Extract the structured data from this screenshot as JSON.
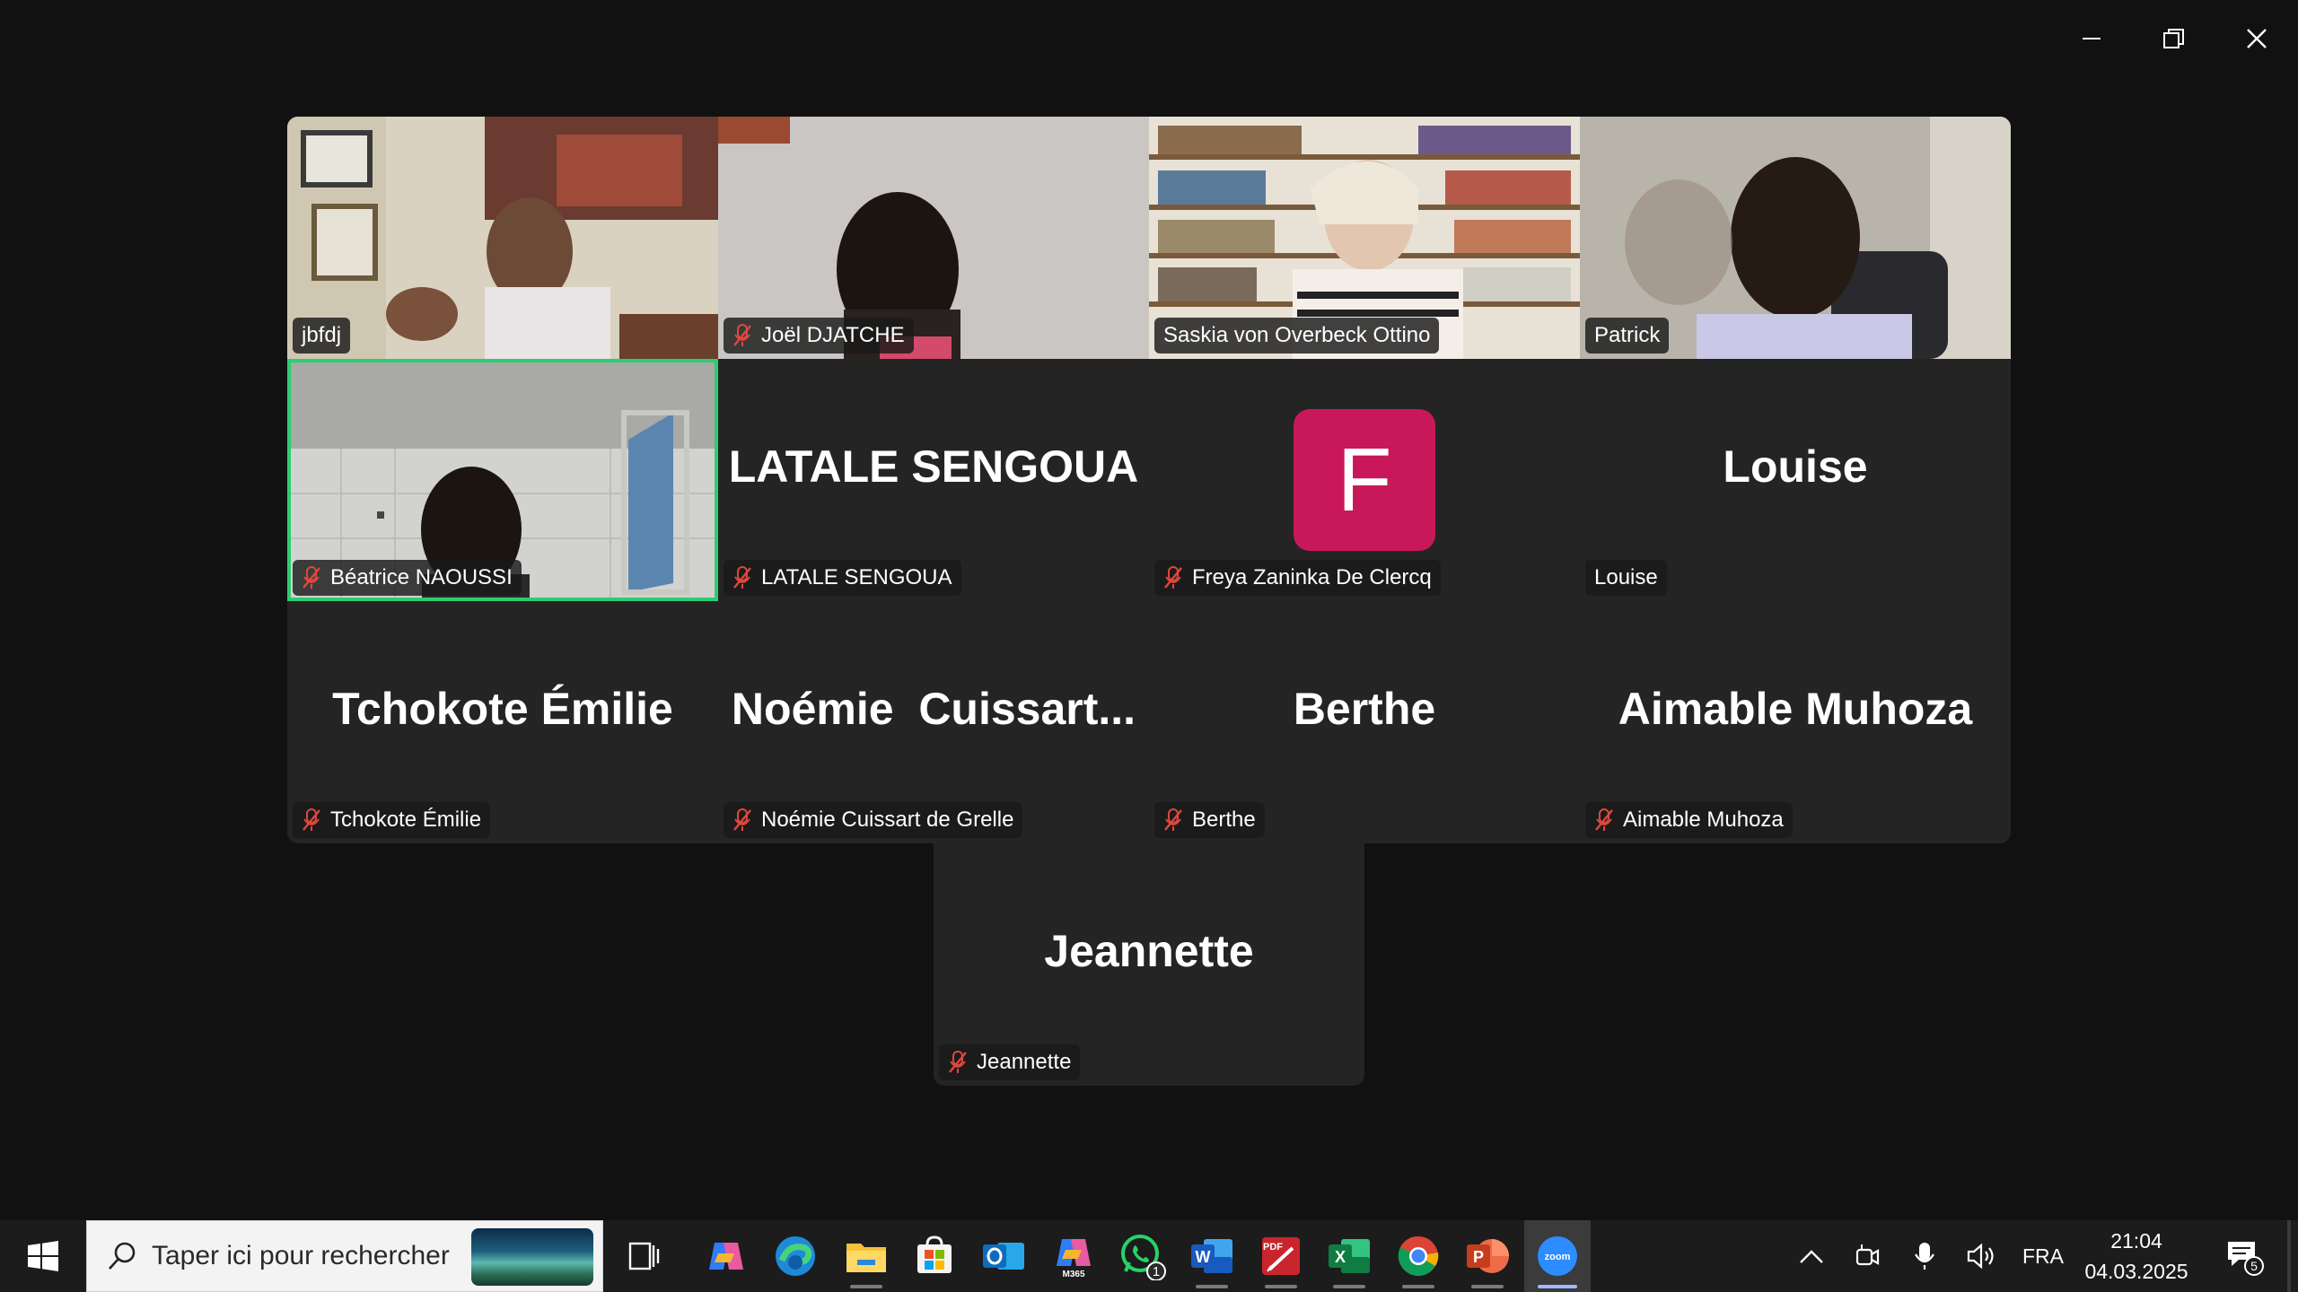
{
  "window_controls": [
    "minimize-icon",
    "restore-icon",
    "close-icon"
  ],
  "participants": [
    {
      "name": "jbfdj",
      "muted": false,
      "video": true
    },
    {
      "name": "Joël DJATCHE",
      "muted": true,
      "video": true
    },
    {
      "name": "Saskia von Overbeck Ottino",
      "muted": false,
      "video": true
    },
    {
      "name": "Patrick",
      "muted": false,
      "video": true
    },
    {
      "name": "Béatrice NAOUSSI",
      "muted": true,
      "video": true,
      "active_speaker": true
    },
    {
      "name": "LATALE SENGOUA",
      "display": "LATALE SENGOUA",
      "muted": true,
      "video": false
    },
    {
      "name": "Freya Zaninka De Clercq",
      "avatar_letter": "F",
      "muted": true,
      "video": false
    },
    {
      "name": "Louise",
      "display": "Louise",
      "muted": false,
      "video": false
    },
    {
      "name": "Tchokote Émilie",
      "display": "Tchokote Émilie",
      "muted": true,
      "video": false
    },
    {
      "name": "Noémie Cuissart de Grelle",
      "display": "Noémie  Cuissart...",
      "muted": true,
      "video": false
    },
    {
      "name": "Berthe",
      "display": "Berthe",
      "muted": true,
      "video": false
    },
    {
      "name": "Aimable Muhoza",
      "display": "Aimable Muhoza",
      "muted": true,
      "video": false
    },
    {
      "name": "Jeannette",
      "display": "Jeannette",
      "muted": true,
      "video": false
    }
  ],
  "colors": {
    "active_speaker_border": "#2ecc71",
    "avatar_bg": "#c8185a",
    "mute_red": "#e0473d"
  },
  "taskbar": {
    "search_placeholder": "Taper ici pour rechercher",
    "apps": [
      "task-view-icon",
      "copilot-icon",
      "edge-icon",
      "file-explorer-icon",
      "ms-store-icon",
      "outlook-icon",
      "m365-icon",
      "whatsapp-icon",
      "word-icon",
      "pdf-icon",
      "excel-icon",
      "chrome-icon",
      "powerpoint-icon",
      "zoom-icon"
    ],
    "whatsapp_badge": "1",
    "m365_label": "M365",
    "pdf_label": "PDF",
    "zoom_label": "zoom",
    "language": "FRA",
    "time": "21:04",
    "date": "04.03.2025",
    "notifications_count": "5"
  }
}
